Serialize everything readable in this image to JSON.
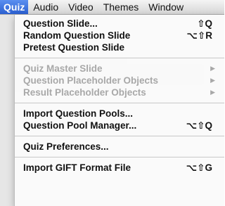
{
  "menubar": {
    "items": [
      "Quiz",
      "Audio",
      "Video",
      "Themes",
      "Window"
    ]
  },
  "quiz_menu": {
    "question_slide": {
      "label": "Question Slide...",
      "shortcut": "⇧Q"
    },
    "random_question_slide": {
      "label": "Random Question Slide",
      "shortcut": "⌥⇧R"
    },
    "pretest_question_slide": {
      "label": "Pretest Question Slide"
    },
    "quiz_master_slide": {
      "label": "Quiz Master Slide"
    },
    "question_placeholder_objects": {
      "label": "Question Placeholder Objects"
    },
    "result_placeholder_objects": {
      "label": "Result Placeholder Objects"
    },
    "import_question_pools": {
      "label": "Import Question Pools..."
    },
    "question_pool_manager": {
      "label": "Question Pool Manager...",
      "shortcut": "⌥⇧Q"
    },
    "quiz_preferences": {
      "label": "Quiz Preferences..."
    },
    "import_gift_format_file": {
      "label": "Import GIFT Format File",
      "shortcut": "⌥⇧G"
    }
  },
  "colors": {
    "highlight": "#3a6fd7",
    "disabled_text": "#a8a8a8"
  }
}
